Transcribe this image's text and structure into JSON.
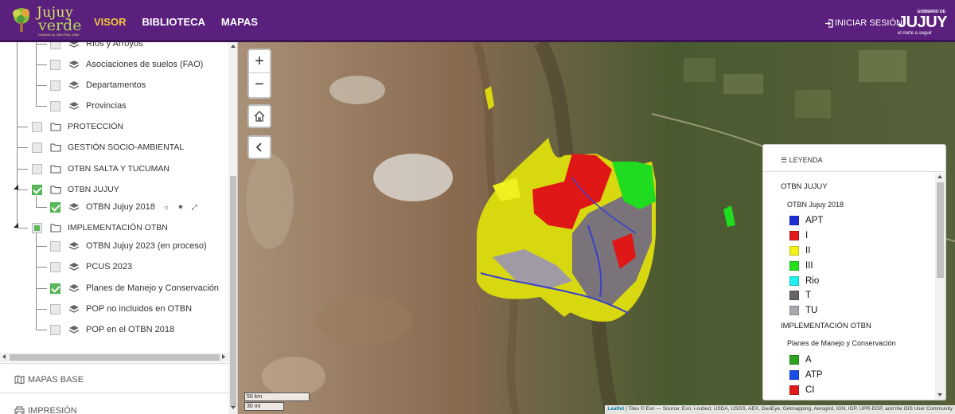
{
  "header": {
    "logo": {
      "line1": "Jujuy",
      "line2": "verde",
      "tagline": "CAMINO AL NEUTRAL 2050"
    },
    "nav": [
      {
        "label": "VISOR",
        "active": true
      },
      {
        "label": "BIBLIOTECA",
        "active": false
      },
      {
        "label": "MAPAS",
        "active": false
      }
    ],
    "login_label": "INICIAR SESIÓN",
    "gov": {
      "small": "GOBIERNO DE",
      "name": "JUJUY",
      "slogan": "el norte a seguir"
    }
  },
  "sidebar": {
    "layers": [
      {
        "label": "Ríos y Arroyos",
        "checked": false
      },
      {
        "label": "Asociaciones de suelos (FAO)",
        "checked": false
      },
      {
        "label": "Departamentos",
        "checked": false
      },
      {
        "label": "Provincias",
        "checked": false
      },
      {
        "label": "PROTECCIÓN",
        "checked": false,
        "folder": true
      },
      {
        "label": "GESTIÓN SOCIO-AMBIENTAL",
        "checked": false,
        "folder": true
      },
      {
        "label": "OTBN SALTA Y TUCUMAN",
        "checked": false,
        "folder": true
      },
      {
        "label": "OTBN JUJUY",
        "checked": true,
        "folder": true
      },
      {
        "label": "OTBN Jujuy 2018",
        "checked": true
      },
      {
        "label": "IMPLEMENTACIÓN OTBN",
        "checked": "partial",
        "folder": true
      },
      {
        "label": "OTBN Jujuy 2023 (en proceso)",
        "checked": false
      },
      {
        "label": "PCUS 2023",
        "checked": false
      },
      {
        "label": "Planes de Manejo y Conservación",
        "checked": true
      },
      {
        "label": "POP no incluidos en OTBN",
        "checked": false
      },
      {
        "label": "POP en el OTBN 2018",
        "checked": false
      }
    ],
    "base_maps_label": "MAPAS BASE",
    "print_label": "IMPRESIÓN"
  },
  "map": {
    "scale_km": "50 km",
    "scale_mi": "30 mi",
    "attribution_leaflet": "Leaflet",
    "attribution_text": "| Tiles © Esri — Source: Esri, i-cubed, USDA, USGS, AEX, GeoEye, Getmapping, Aerogrid, IGN, IGP, UPR-EGP, and the GIS User Community"
  },
  "legend": {
    "title": "LEYENDA",
    "group1": "OTBN JUJUY",
    "layer1": "OTBN Jujuy 2018",
    "items1": [
      {
        "label": "APT",
        "color": "#1f2fd6"
      },
      {
        "label": "I",
        "color": "#e11a1a"
      },
      {
        "label": "II",
        "color": "#f2f21a"
      },
      {
        "label": "III",
        "color": "#22e01a"
      },
      {
        "label": "Rio",
        "color": "#22f0f0"
      },
      {
        "label": "T",
        "color": "#6a6366"
      },
      {
        "label": "TU",
        "color": "#aaa7ae"
      }
    ],
    "group2": "IMPLEMENTACIÓN OTBN",
    "layer2": "Planes de Manejo y Conservación",
    "items2": [
      {
        "label": "A",
        "color": "#2ea31e"
      },
      {
        "label": "ATP",
        "color": "#1a4de8"
      },
      {
        "label": "CI",
        "color": "#e01a1a"
      }
    ]
  }
}
